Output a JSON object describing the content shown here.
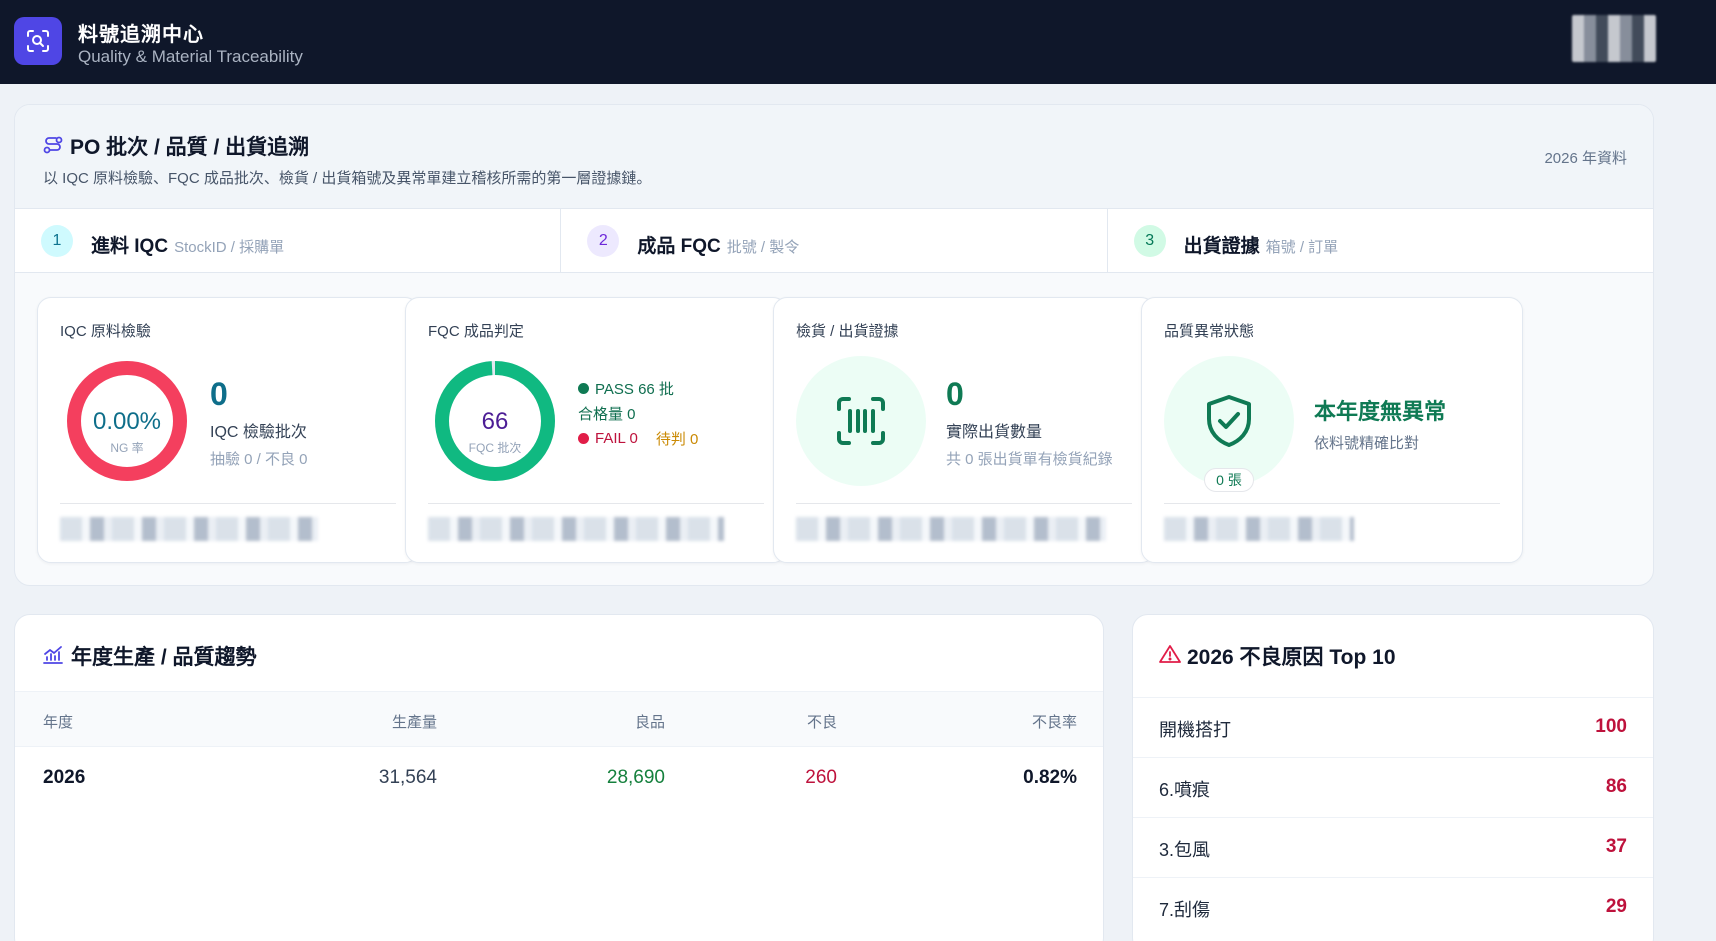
{
  "header": {
    "title": "料號追溯中心",
    "subtitle": "Quality & Material Traceability"
  },
  "po": {
    "title": "PO 批次 / 品質 / 出貨追溯",
    "description": "以 IQC 原料檢驗、FQC 成品批次、檢貨 / 出貨箱號及異常單建立稽核所需的第一層證據鏈。",
    "year_label": "2026 年資料",
    "steps": [
      {
        "num": "1",
        "label": "進料 IQC",
        "hint": "StockID / 採購單"
      },
      {
        "num": "2",
        "label": "成品 FQC",
        "hint": "批號 / 製令"
      },
      {
        "num": "3",
        "label": "出貨證據",
        "hint": "箱號 / 訂單"
      }
    ]
  },
  "metrics": {
    "iqc": {
      "title": "IQC 原料檢驗",
      "ng_rate": "0.00%",
      "ng_label": "NG 率",
      "count": "0",
      "count_label": "IQC 檢驗批次",
      "detail": "抽驗 0 / 不良 0"
    },
    "fqc": {
      "title": "FQC 成品判定",
      "batches": "66",
      "batches_label": "FQC 批次",
      "pass": "PASS 66 批",
      "qualified": "合格量 0",
      "fail": "FAIL 0",
      "pending": "待判 0",
      "pass_fraction": 0.99
    },
    "shipping": {
      "title": "檢貨 / 出貨證據",
      "count": "0",
      "count_label": "實際出貨數量",
      "detail": "共 0 張出貨單有檢貨紀錄"
    },
    "anomaly": {
      "title": "品質異常狀態",
      "status": "本年度無異常",
      "detail": "依料號精確比對",
      "badge": "0 張"
    }
  },
  "trend": {
    "title": "年度生產 / 品質趨勢",
    "columns": [
      "年度",
      "生產量",
      "良品",
      "不良",
      "不良率"
    ],
    "rows": [
      {
        "year": "2026",
        "production": "31,564",
        "good": "28,690",
        "defect": "260",
        "rate": "0.82%"
      }
    ]
  },
  "top10": {
    "title": "2026 不良原因 Top 10",
    "items": [
      {
        "name": "開機搭打",
        "count": "100"
      },
      {
        "name": "6.噴痕",
        "count": "86"
      },
      {
        "name": "3.包風",
        "count": "37"
      },
      {
        "name": "7.刮傷",
        "count": "29"
      }
    ]
  },
  "colors": {
    "brand": "#4f46e5",
    "header_bg": "#0f172a",
    "ng": "#f43f5e",
    "pass": "#10b981",
    "fail": "#e11d48",
    "pending": "#ca8a04",
    "shipping": "#0f7a54",
    "iqc_value": "#0e6e8a"
  }
}
